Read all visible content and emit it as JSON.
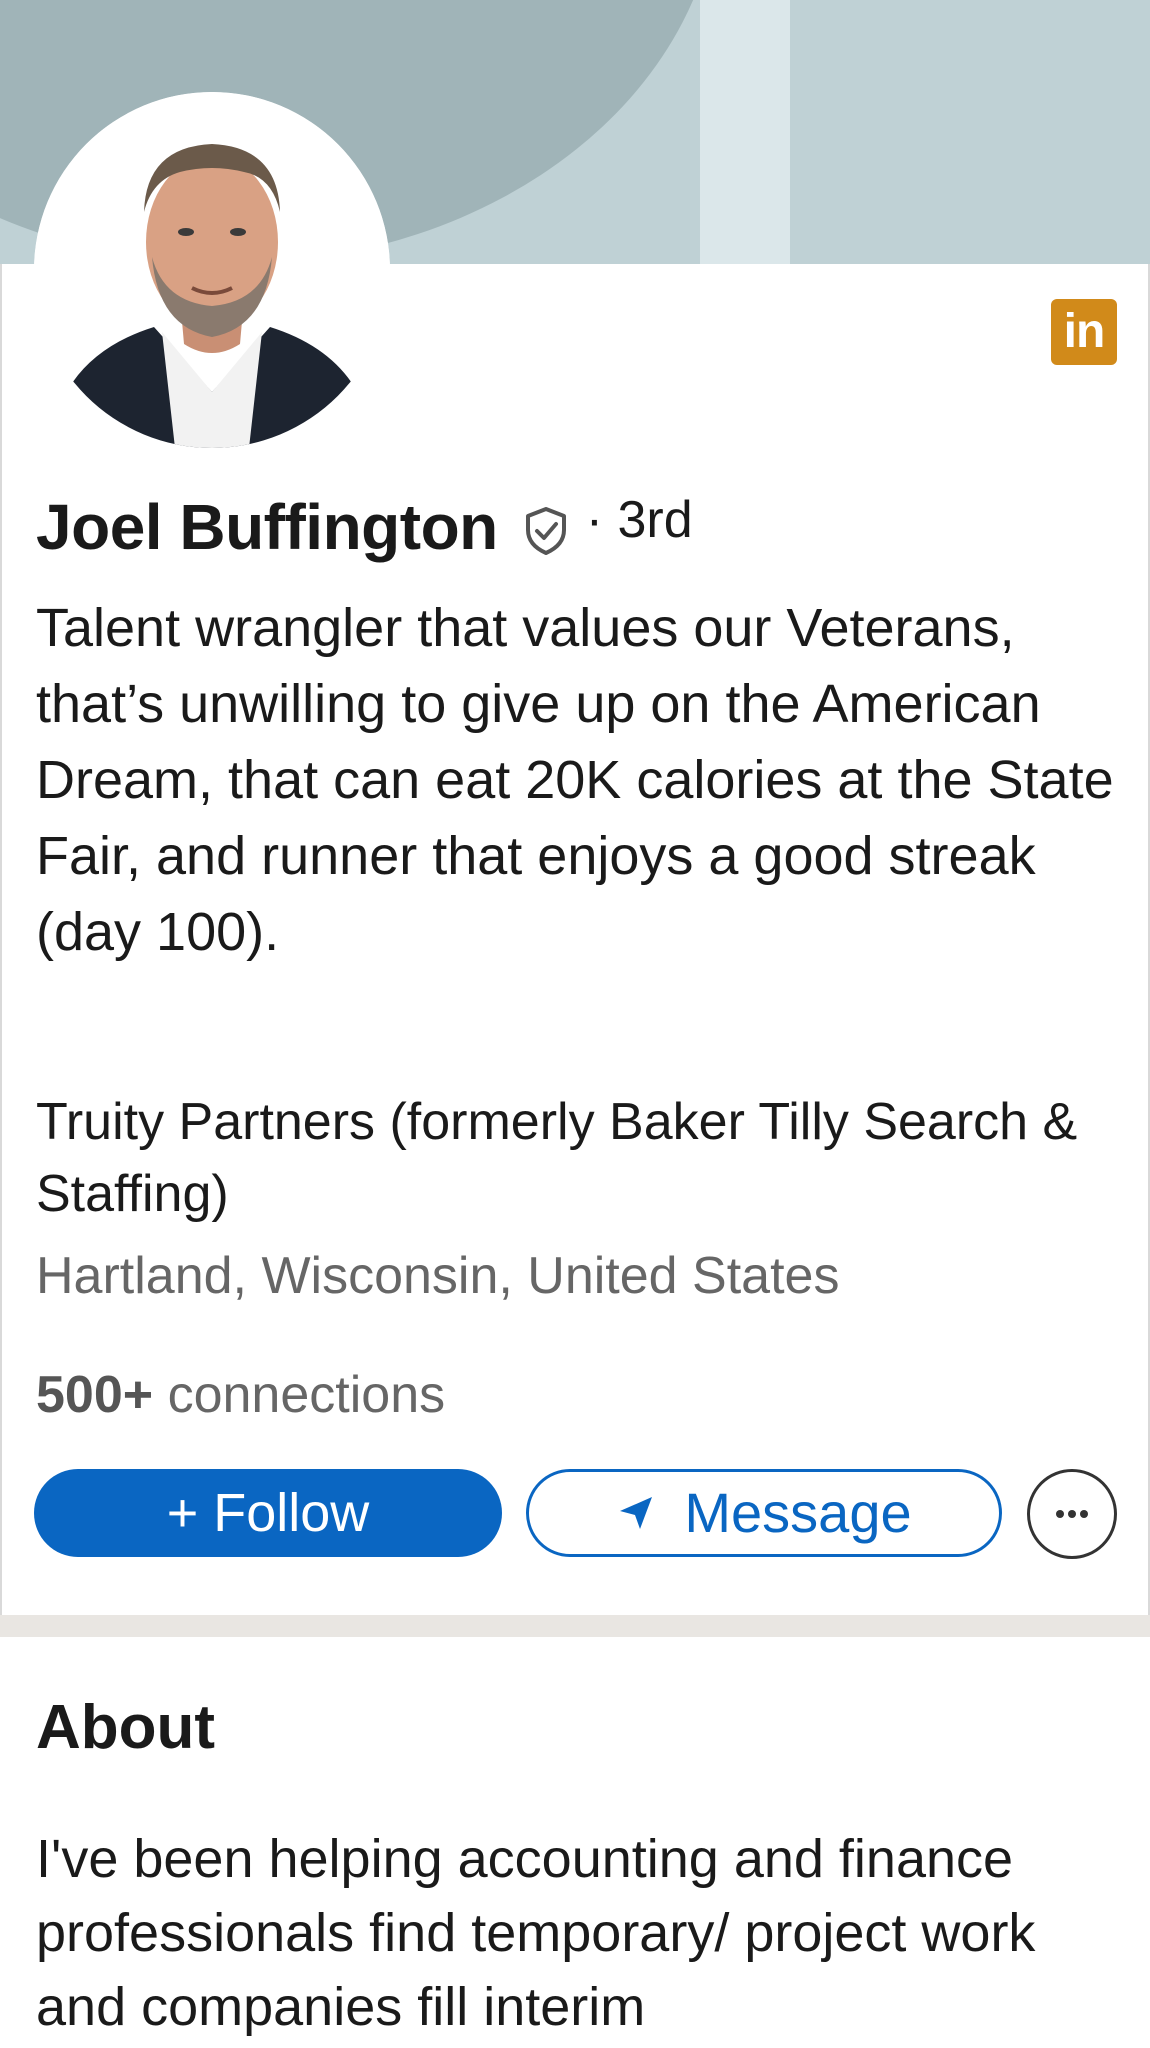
{
  "profile": {
    "name": "Joel Buffington",
    "degree": "· 3rd",
    "headline": "Talent wrangler that values our Veterans, that’s unwilling to give up on the American Dream, that can eat 20K calories at the State Fair, and runner that enjoys a good streak (day 100).",
    "company": "Truity Partners (formerly Baker Tilly Search & Staffing)",
    "location": "Hartland, Wisconsin, United States",
    "connections_count": "500+",
    "connections_label": " connections",
    "badge_text": "in"
  },
  "actions": {
    "follow_label": "+ Follow",
    "message_label": "Message",
    "more_icon": "more-icon"
  },
  "about": {
    "title": "About",
    "text": "I've been helping accounting and finance professionals find temporary/ project work and companies fill interim"
  },
  "colors": {
    "accent": "#0a66c2",
    "banner": "#bfd1d5",
    "banner_dark": "#a0b4b8",
    "badge": "#d18a1a"
  }
}
